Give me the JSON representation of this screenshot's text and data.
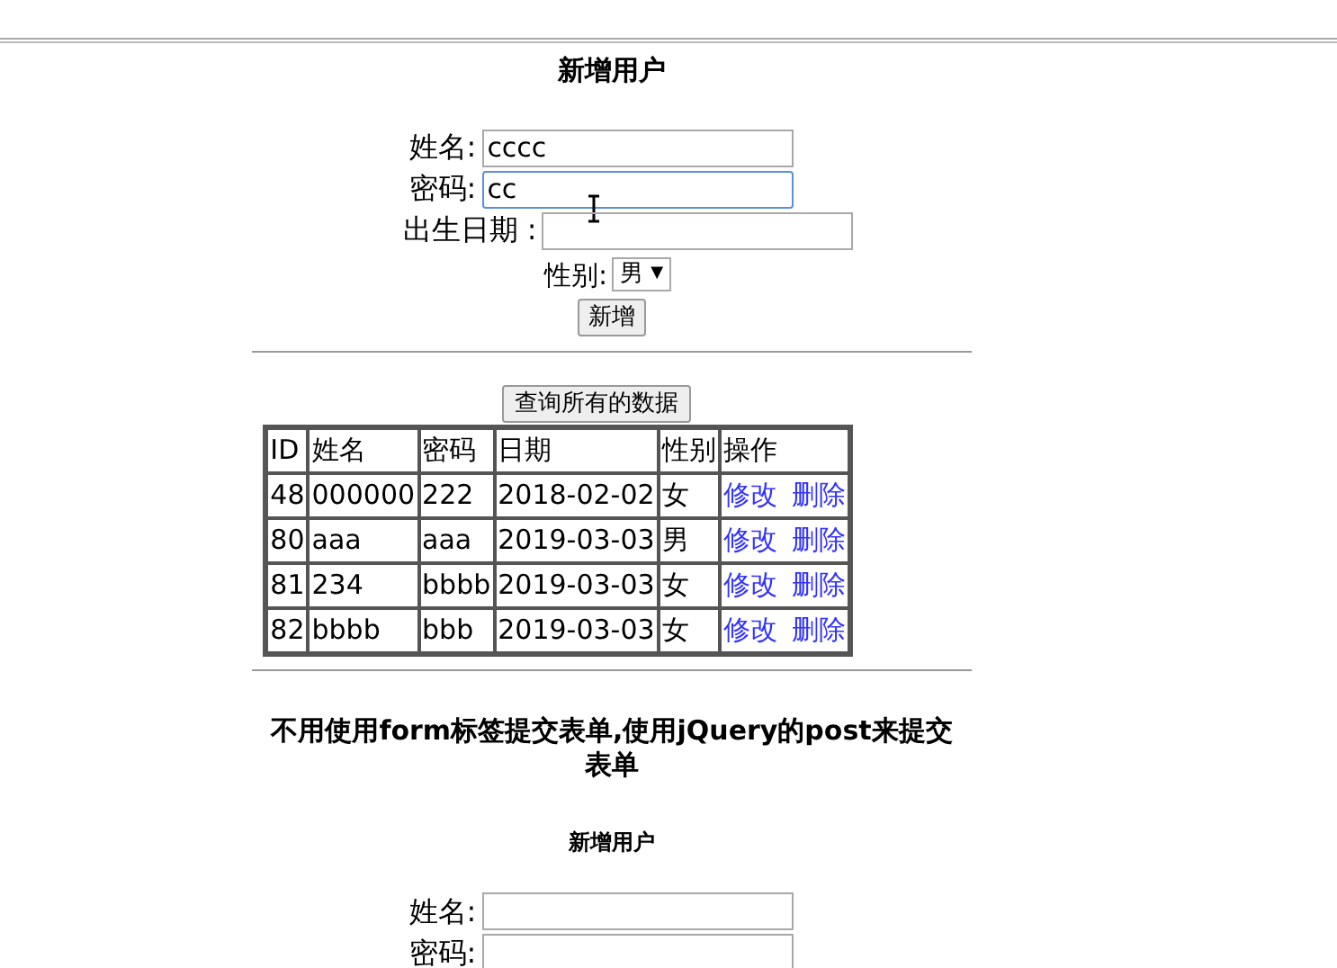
{
  "form": {
    "title": "新增用户",
    "fields": [
      {
        "label": "姓名:",
        "value": "cccc",
        "focused": false,
        "kind": "name"
      },
      {
        "label": "密码:",
        "value": "cc",
        "focused": true,
        "kind": "password"
      },
      {
        "label": "出生日期 :",
        "focused": false,
        "kind": "date"
      }
    ],
    "gender": {
      "label": "性别:",
      "value": "男",
      "arrow": "▼"
    },
    "submit": "新增"
  },
  "query_button": "查询所有的数据",
  "table": {
    "columns": [
      "ID",
      "姓名",
      "密码",
      "日期",
      "性别",
      "操作"
    ],
    "rows": [
      {
        "cells": [
          "48",
          "000000",
          "222",
          "2018-02-02",
          "女"
        ],
        "actions": [
          "修改",
          "删除"
        ]
      },
      {
        "cells": [
          "80",
          "aaa",
          "aaa",
          "2019-03-03",
          "男"
        ],
        "actions": [
          "修改",
          "删除"
        ]
      },
      {
        "cells": [
          "81",
          "234",
          "bbbb",
          "2019-03-03",
          "女"
        ],
        "actions": [
          "修改",
          "删除"
        ]
      },
      {
        "cells": [
          "82",
          "bbbb",
          "bbb",
          "2019-03-03",
          "女"
        ],
        "actions": [
          "修改",
          "删除"
        ]
      }
    ]
  },
  "section2": {
    "heading": "不用使用form标签提交表单,使用jQuery的post来提交表单",
    "title": "新增用户",
    "fields": [
      {
        "label": "姓名:",
        "focused": false
      },
      {
        "label": "密码:",
        "focused": false
      }
    ]
  }
}
